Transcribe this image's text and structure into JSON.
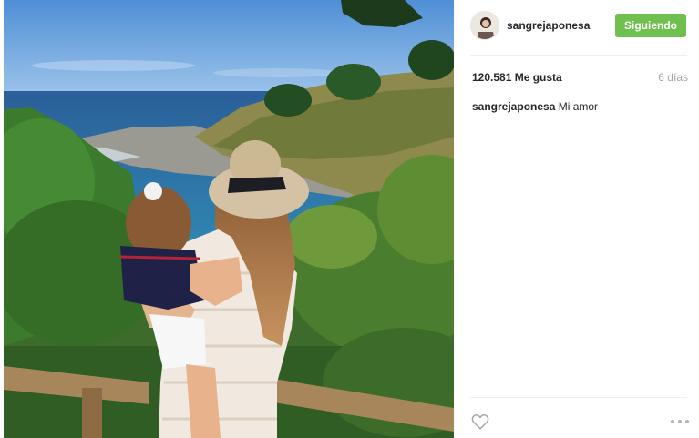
{
  "post": {
    "username": "sangrejaponesa",
    "follow_label": "Siguiendo",
    "likes": "120.581 Me gusta",
    "time_ago": "6 días",
    "caption_user": "sangrejaponesa",
    "caption_text": "Mi amor"
  },
  "icons": {
    "like": "heart-outline-icon",
    "options": "more-options-icon"
  },
  "colors": {
    "follow_button": "#70c050",
    "muted_text": "#a5a7aa"
  }
}
